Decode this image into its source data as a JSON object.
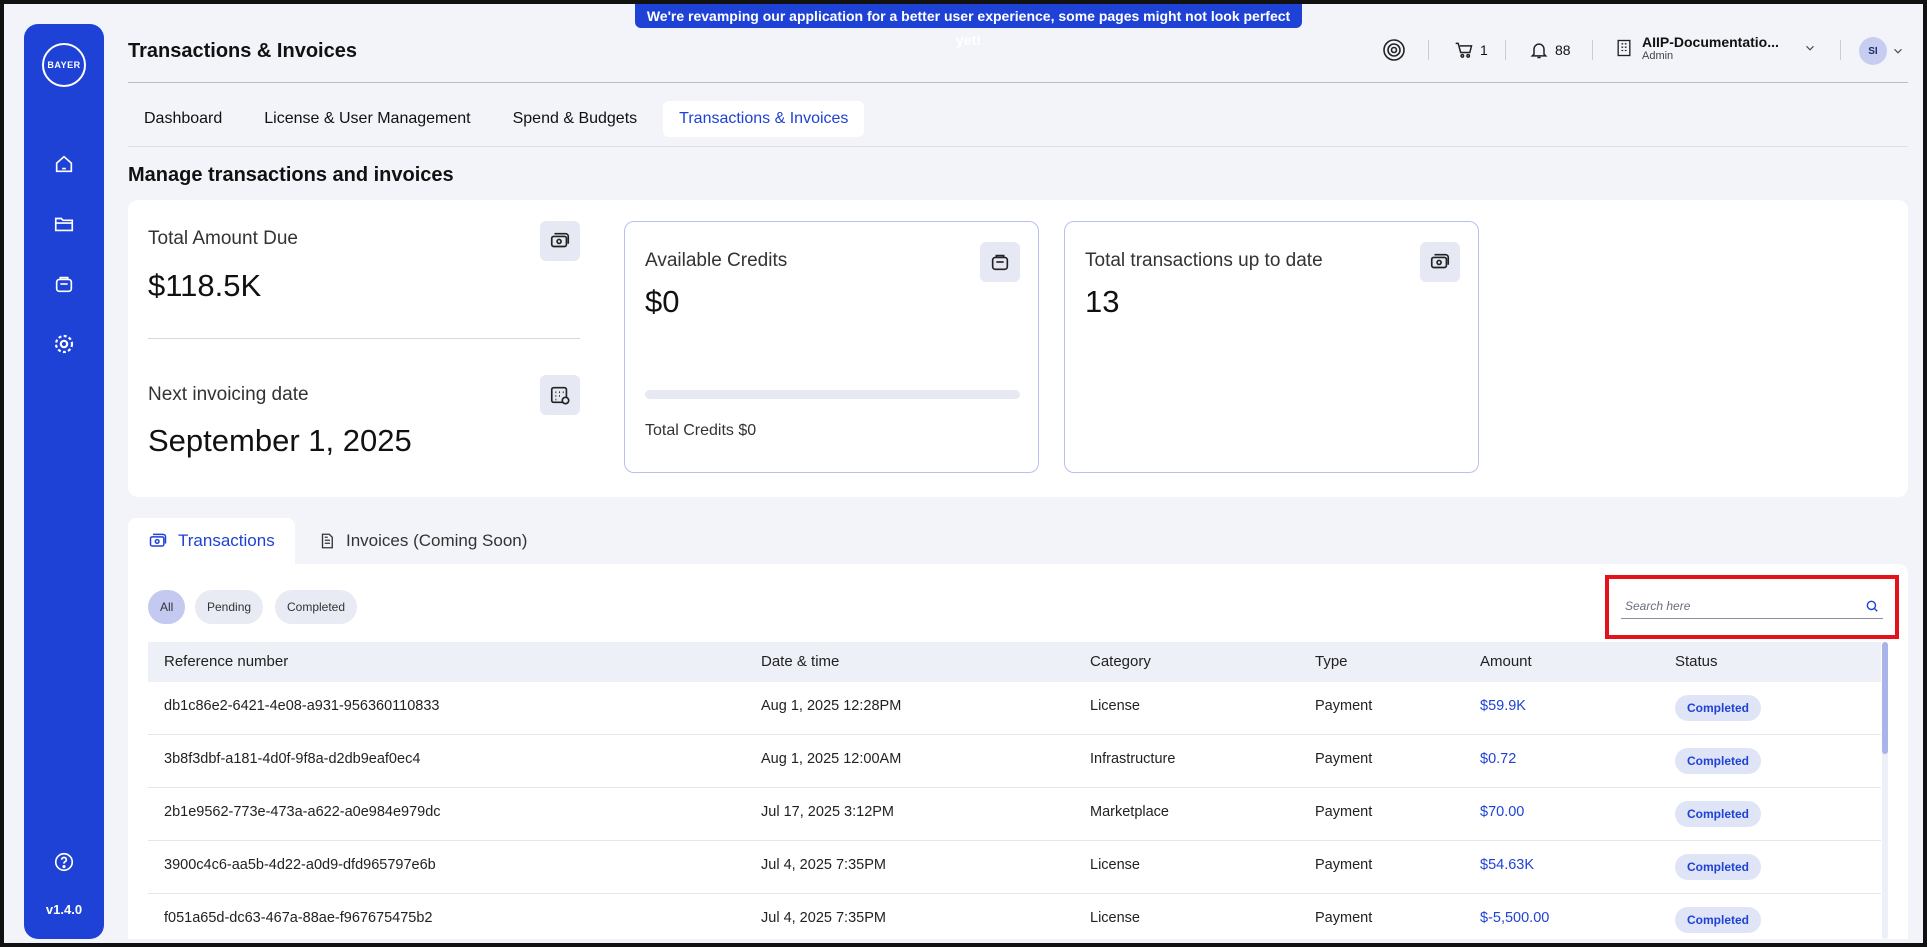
{
  "banner": "We're revamping our application for a better user experience, some pages might not look perfect yet!",
  "sidebar": {
    "logo_text": "BAYER",
    "logo_vertical": [
      "B",
      "A",
      "Y",
      "E",
      "R"
    ],
    "version": "v1.4.0"
  },
  "header": {
    "title": "Transactions & Invoices",
    "cart_count": "1",
    "notification_count": "88",
    "org_name": "AIIP-Documentatio...",
    "org_role": "Admin",
    "avatar_initials": "SI"
  },
  "tabs": [
    {
      "label": "Dashboard"
    },
    {
      "label": "License & User Management"
    },
    {
      "label": "Spend & Budgets"
    },
    {
      "label": "Transactions & Invoices"
    }
  ],
  "section_title": "Manage transactions and invoices",
  "summary": {
    "total_due_label": "Total Amount Due",
    "total_due_value": "$118.5K",
    "next_invoice_label": "Next invoicing date",
    "next_invoice_value": "September 1, 2025",
    "credits_label": "Available Credits",
    "credits_value": "$0",
    "credits_progress": 0,
    "total_credits": "Total Credits $0",
    "transactions_label": "Total transactions up to date",
    "transactions_value": "13"
  },
  "lower_tabs": {
    "transactions": "Transactions",
    "invoices": "Invoices (Coming Soon)"
  },
  "filters": [
    "All",
    "Pending",
    "Completed"
  ],
  "search": {
    "placeholder": "Search here",
    "value": ""
  },
  "table": {
    "columns": [
      "Reference number",
      "Date & time",
      "Category",
      "Type",
      "Amount",
      "Status"
    ],
    "rows": [
      {
        "ref": "db1c86e2-6421-4e08-a931-956360110833",
        "date": "Aug 1, 2025 12:28PM",
        "category": "License",
        "type": "Payment",
        "amount": "$59.9K",
        "status": "Completed"
      },
      {
        "ref": "3b8f3dbf-a181-4d0f-9f8a-d2db9eaf0ec4",
        "date": "Aug 1, 2025 12:00AM",
        "category": "Infrastructure",
        "type": "Payment",
        "amount": "$0.72",
        "status": "Completed"
      },
      {
        "ref": "2b1e9562-773e-473a-a622-a0e984e979dc",
        "date": "Jul 17, 2025 3:12PM",
        "category": "Marketplace",
        "type": "Payment",
        "amount": "$70.00",
        "status": "Completed"
      },
      {
        "ref": "3900c4c6-aa5b-4d22-a0d9-dfd965797e6b",
        "date": "Jul 4, 2025 7:35PM",
        "category": "License",
        "type": "Payment",
        "amount": "$54.63K",
        "status": "Completed"
      },
      {
        "ref": "f051a65d-dc63-467a-88ae-f967675475b2",
        "date": "Jul 4, 2025 7:35PM",
        "category": "License",
        "type": "Payment",
        "amount": "$-5,500.00",
        "status": "Completed"
      }
    ]
  },
  "colors": {
    "brand": "#1f42d6",
    "highlight": "#e3121b"
  }
}
